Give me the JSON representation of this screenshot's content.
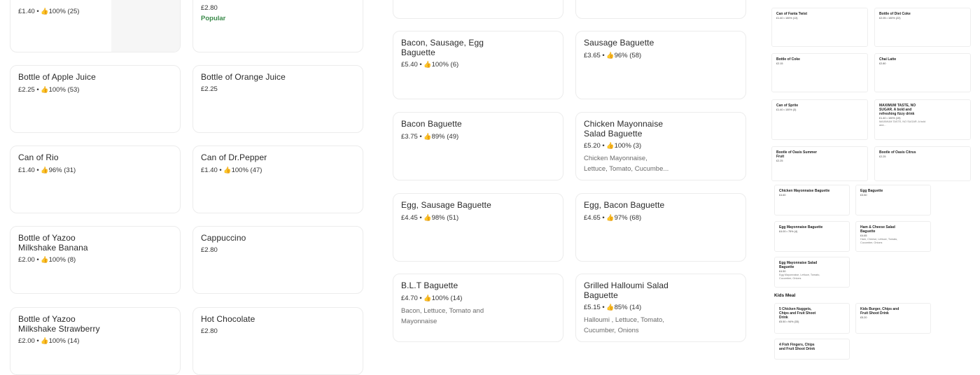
{
  "left_column": [
    {
      "price": "£1.40",
      "rating": "100% (25)"
    },
    {
      "name": "Bottle of Apple Juice",
      "price": "£2.25",
      "rating": "100% (53)"
    },
    {
      "name": "Can of Rio",
      "price": "£1.40",
      "rating": "96% (31)"
    },
    {
      "name": "Bottle of Yazoo Milkshake Banana",
      "price": "£2.00",
      "rating": "100% (8)"
    },
    {
      "name": "Bottle of Yazoo Milkshake Strawberry",
      "price": "£2.00",
      "rating": "100% (14)"
    }
  ],
  "middle_column": [
    {
      "price": "£2.80",
      "badge": "Popular"
    },
    {
      "name": "Bottle of Orange Juice",
      "price": "£2.25"
    },
    {
      "name": "Can of Dr.Pepper",
      "price": "£1.40",
      "rating": "100% (47)"
    },
    {
      "name": "Cappuccino",
      "price": "£2.80"
    },
    {
      "name": "Hot Chocolate",
      "price": "£2.80"
    }
  ],
  "baguettes_left": [
    {
      "name": "Bacon, Sausage, Egg Baguette",
      "price": "£5.40",
      "rating": "100% (6)"
    },
    {
      "name": "Bacon Baguette",
      "price": "£3.75",
      "rating": "89% (49)"
    },
    {
      "name": "Egg, Sausage Baguette",
      "price": "£4.45",
      "rating": "98% (51)"
    },
    {
      "name": "B.L.T Baguette",
      "price": "£4.70",
      "rating": "100% (14)",
      "desc": "Bacon, Lettuce, Tomato and Mayonnaise"
    }
  ],
  "baguettes_right": [
    {
      "name": "Sausage Baguette",
      "price": "£3.65",
      "rating": "96% (58)"
    },
    {
      "name": "Chicken Mayonnaise Salad Baguette",
      "price": "£5.20",
      "rating": "100% (3)",
      "desc": "Chicken Mayonnaise, Lettuce, Tomato, Cucumbe..."
    },
    {
      "name": "Egg, Bacon Baguette",
      "price": "£4.65",
      "rating": "97% (68)"
    },
    {
      "name": "Grilled Halloumi Salad Baguette",
      "price": "£5.15",
      "rating": "85% (14)",
      "desc": "Halloumi , Lettuce, Tomato, Cucumber, Onions"
    }
  ],
  "minimap": {
    "drinks": [
      {
        "name": "Can of Fanta Twist",
        "meta": "£1.40 • 100% (13)"
      },
      {
        "name": "Bottle of Diet Coke",
        "meta": "£2.05 • 100% (22)"
      },
      {
        "name": "Bottle of Coke",
        "meta": "£2.15"
      },
      {
        "name": "Chai Latte",
        "meta": "£2.80"
      },
      {
        "name": "Can of Sprite",
        "meta": "£1.40 • 100% (3)"
      },
      {
        "name": "MAXIMUM TASTE, NO SUGAR. A bold and refreshing fizzy drink",
        "meta": "£1.40 • 100% (19)",
        "desc": "MAXIMUM TASTE, NO SUGAR. A bold and..."
      },
      {
        "name": "Bootle of Oasis Summer Fruit",
        "meta": "£2.25"
      },
      {
        "name": "Bootle of Oasis Citrus",
        "meta": "£2.25"
      }
    ],
    "baguettes": [
      {
        "name": "Chicken Mayonnaise Baguette",
        "meta": "£4.60"
      },
      {
        "name": "Egg Baguette",
        "meta": "£3.50"
      },
      {
        "name": "Egg Mayonnaise Baguette",
        "meta": "£4.00 • 75% (4)"
      },
      {
        "name": "Ham & Cheese Salad Baguette",
        "meta": "£4.65",
        "desc": "Ham, Cheese, Lettuce, Tomato, Cucumber, Onions"
      },
      {
        "name": "Egg Mayonnaise Salad Baguette",
        "meta": "£4.50",
        "desc": "Egg Mayonnaise, Lettuce, Tomato, Cucumber, Onions"
      }
    ],
    "kids_heading": "Kids Meal",
    "kids": [
      {
        "name": "5 Chicken Nuggets, Chips and Fruit Shoot Drink",
        "meta": "£5.50 • 94% (33)"
      },
      {
        "name": "Kids Burger, Chips and Fruit Shoot Drink",
        "meta": "£5.20"
      },
      {
        "name": "4 Fish Fingers, Chips and Fruit Shoot Drink",
        "meta": ""
      }
    ]
  },
  "icons": {
    "rating": "thumbs-up-icon"
  }
}
